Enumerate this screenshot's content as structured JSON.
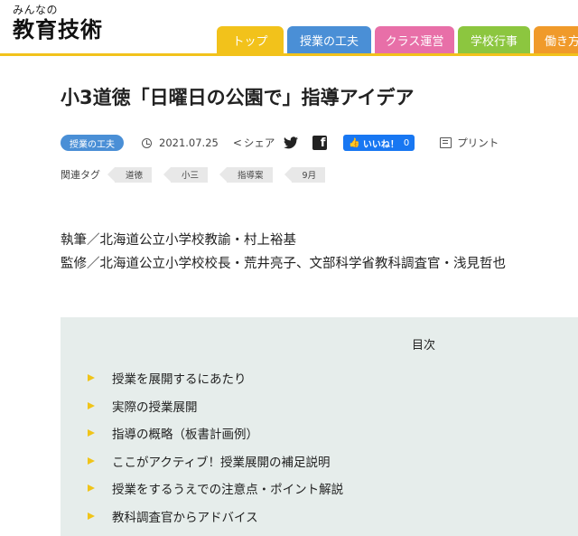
{
  "site": {
    "logo_small": "みんなの",
    "logo_big": "教育技術"
  },
  "nav": [
    {
      "label": "トップ",
      "color": "#f2c21b"
    },
    {
      "label": "授業の工夫",
      "color": "#4a8fd6"
    },
    {
      "label": "クラス運営",
      "color": "#e86fa8"
    },
    {
      "label": "学校行事",
      "color": "#8cc63f"
    },
    {
      "label": "働き方の",
      "color": "#f09a2a"
    }
  ],
  "article": {
    "title": "小3道徳「日曜日の公園で」指導アイデア",
    "category": "授業の工夫",
    "date": "2021.07.25",
    "share_label": "シェア",
    "like_label": "いいね！",
    "like_count": "0",
    "print_label": "プリント",
    "tags_label": "関連タグ",
    "tags": [
      "道徳",
      "小三",
      "指導案",
      "9月"
    ],
    "author": "執筆／北海道公立小学校教諭・村上裕基",
    "supervisor": "監修／北海道公立小学校校長・荒井亮子、文部科学省教科調査官・浅見哲也"
  },
  "toc": {
    "title": "目次",
    "items": [
      "授業を展開するにあたり",
      "実際の授業展開",
      "指導の概略（板書計画例）",
      "ここがアクティブ！授業展開の補足説明",
      "授業をするうえでの注意点・ポイント解説",
      "教科調査官からアドバイス"
    ]
  },
  "colors": {
    "accent": "#f2c21b",
    "category_badge": "#4a8fd6",
    "like_button": "#1877f2",
    "toc_background": "#e6edeb"
  },
  "icons": [
    "clock-icon",
    "share-icon",
    "twitter-icon",
    "facebook-icon",
    "thumbs-up-icon",
    "printer-icon",
    "triangle-bullet-icon"
  ]
}
